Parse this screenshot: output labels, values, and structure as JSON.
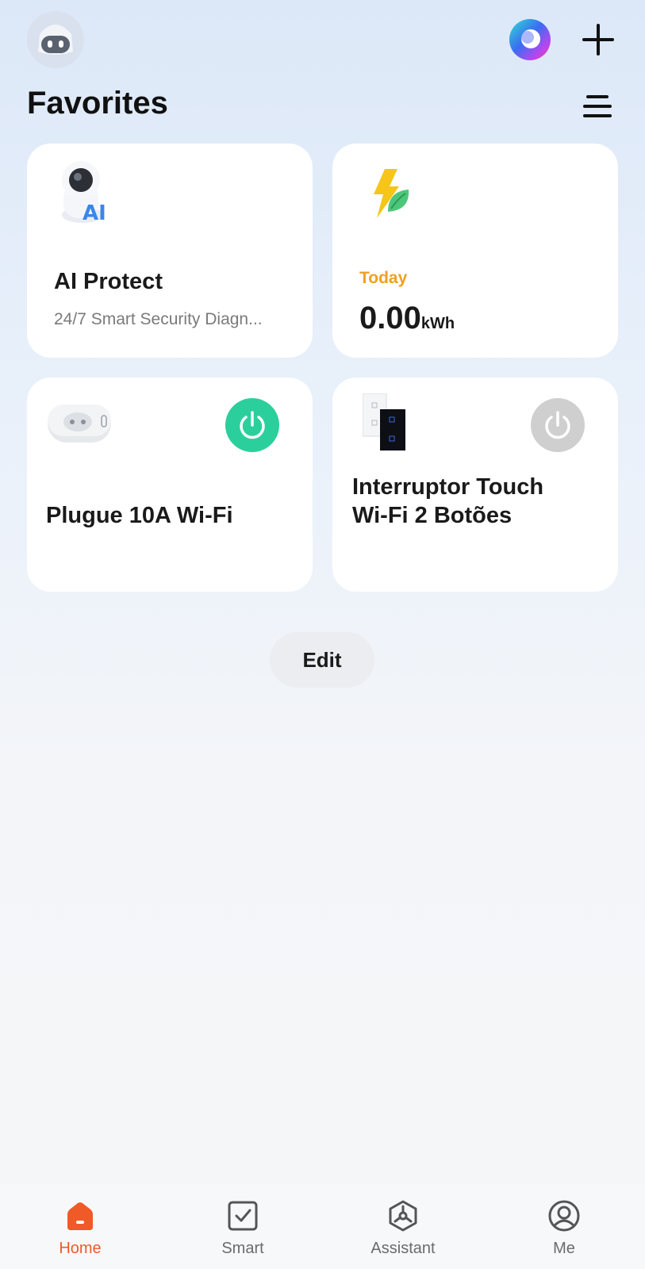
{
  "header": {
    "title": "Favorites",
    "avatar_icon": "robot-avatar-icon",
    "assistant_icon": "ai-orb-icon",
    "add_icon": "plus-icon",
    "menu_icon": "list-menu-icon"
  },
  "cards": {
    "ai_protect": {
      "title": "AI Protect",
      "subtitle": "24/7 Smart Security Diagn...",
      "icon": "ai-camera-icon"
    },
    "energy": {
      "label": "Today",
      "value": "0.00",
      "unit": "kWh",
      "icon": "energy-bolt-leaf-icon"
    },
    "plug": {
      "title": "Plugue 10A Wi-Fi",
      "power_state": "on",
      "icon": "smart-plug-icon"
    },
    "switch": {
      "title_line1": "Interruptor Touch",
      "title_line2": "Wi-Fi 2 Botões",
      "power_state": "off",
      "icon": "touch-switch-icon"
    }
  },
  "edit_label": "Edit",
  "tabs": [
    {
      "label": "Home",
      "icon": "home-icon",
      "active": true
    },
    {
      "label": "Smart",
      "icon": "checkbox-icon",
      "active": false
    },
    {
      "label": "Assistant",
      "icon": "assistant-icon",
      "active": false
    },
    {
      "label": "Me",
      "icon": "user-icon",
      "active": false
    }
  ],
  "colors": {
    "accent": "#f05a28",
    "power_on": "#2bcf9c",
    "power_off": "#cfcfcf",
    "today_label": "#f0a020"
  }
}
